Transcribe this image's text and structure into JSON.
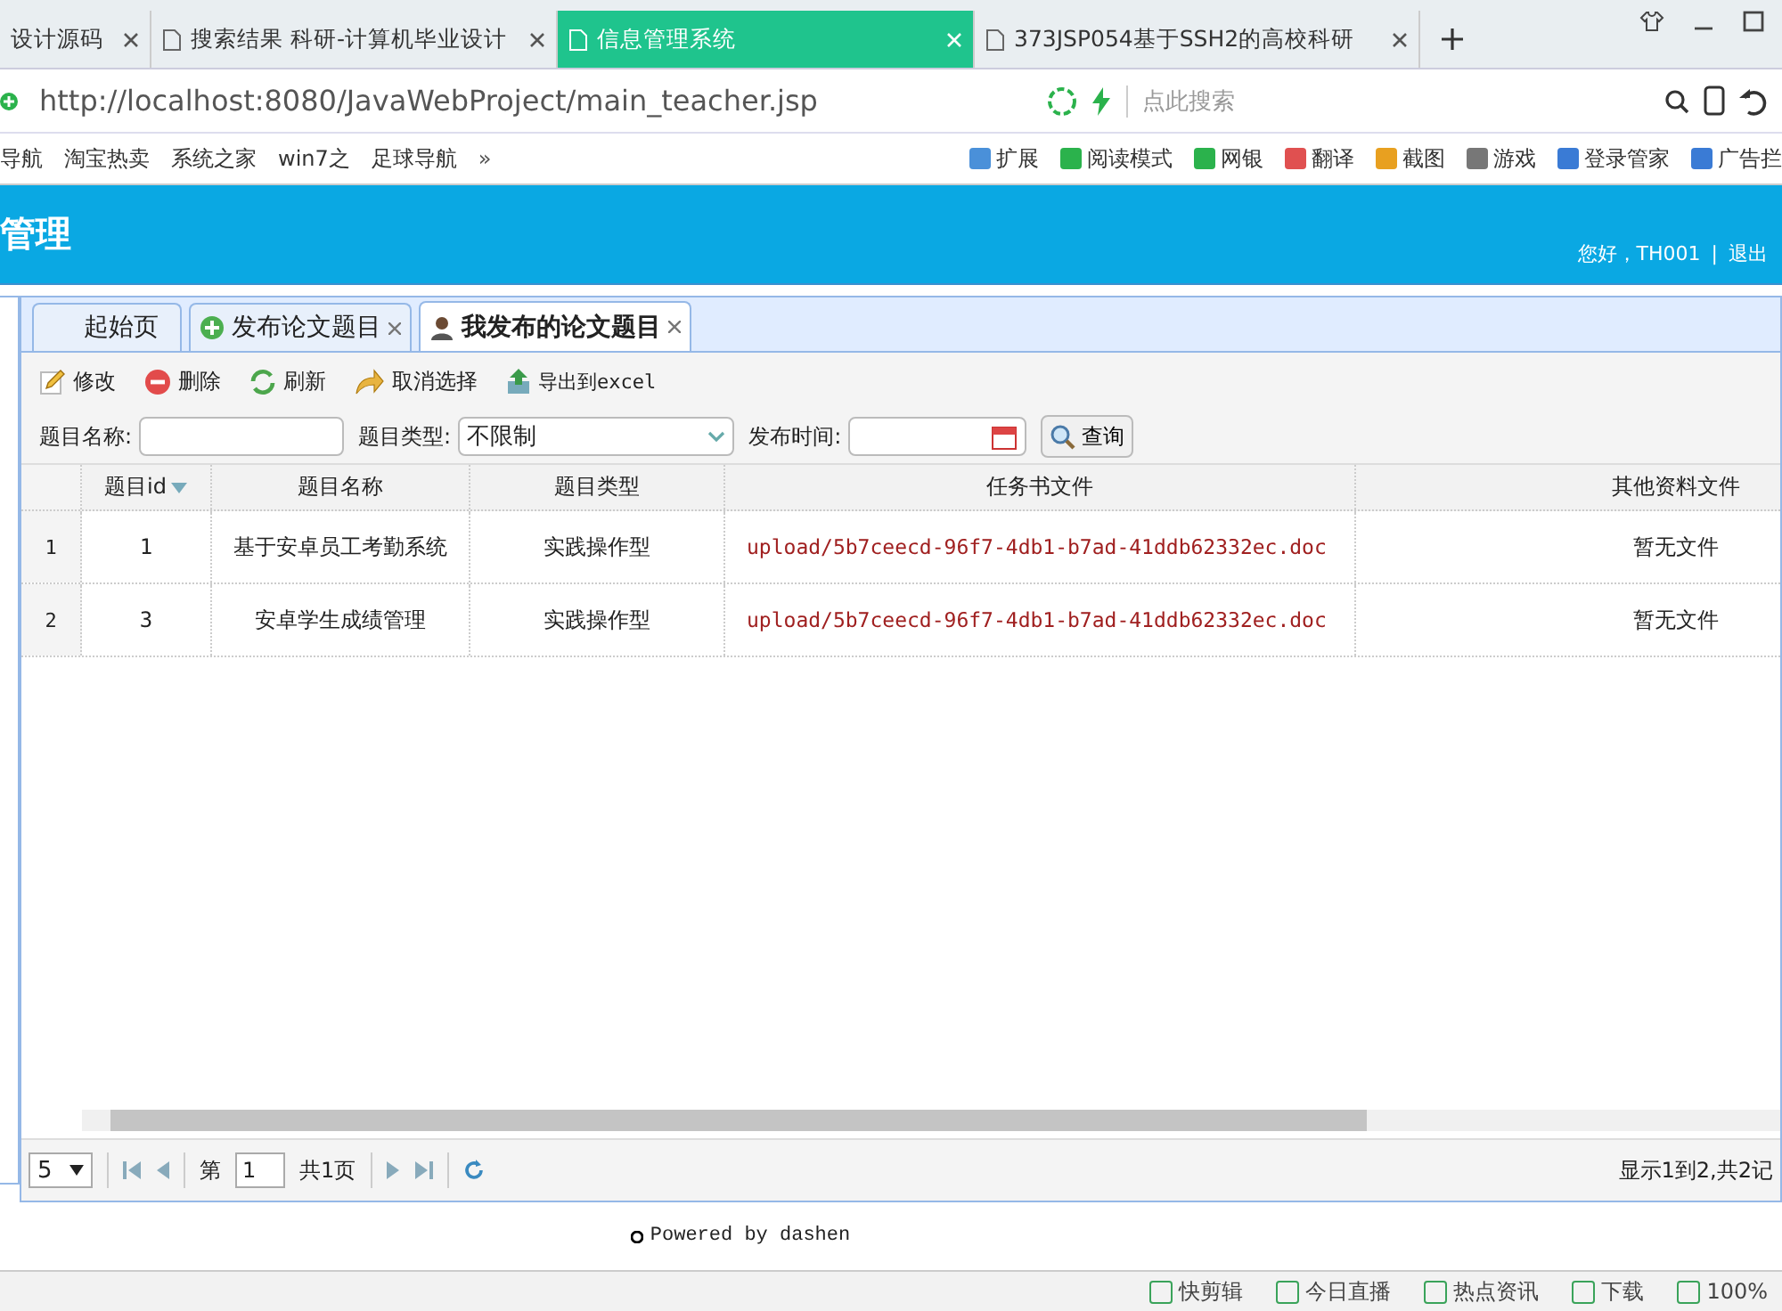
{
  "browser": {
    "tabs": [
      {
        "title": "设计源码",
        "selected": false
      },
      {
        "title": "搜索结果 科研-计算机毕业设计",
        "selected": false
      },
      {
        "title": "信息管理系统",
        "selected": true
      },
      {
        "title": "373JSP054基于SSH2的高校科研",
        "selected": false
      }
    ],
    "url": "http://localhost:8080/JavaWebProject/main_teacher.jsp",
    "search_placeholder": "点此搜索",
    "bookmarks": [
      "导航",
      "淘宝热卖",
      "系统之家",
      "win7之",
      "足球导航"
    ],
    "bookmarks_more": "»",
    "extensions": [
      "扩展",
      "阅读模式",
      "网银",
      "翻译",
      "截图",
      "游戏",
      "登录管家",
      "广告拦"
    ]
  },
  "app": {
    "title": "管理",
    "greeting": "您好，TH001",
    "separator": "|",
    "logout": "退出"
  },
  "page_tabs": [
    {
      "label": "起始页",
      "selected": false,
      "kind": "home",
      "closable": false
    },
    {
      "label": "发布论文题目",
      "selected": false,
      "kind": "add",
      "closable": true
    },
    {
      "label": "我发布的论文题目",
      "selected": true,
      "kind": "user",
      "closable": true
    }
  ],
  "toolbar": [
    {
      "label": "修改",
      "kind": "edit"
    },
    {
      "label": "删除",
      "kind": "delete"
    },
    {
      "label": "刷新",
      "kind": "refresh"
    },
    {
      "label": "取消选择",
      "kind": "cancel"
    },
    {
      "label": "导出到excel",
      "kind": "export"
    }
  ],
  "filters": {
    "name_label": "题目名称:",
    "type_label": "题目类型:",
    "type_value": "不限制",
    "time_label": "发布时间:",
    "query": "查询"
  },
  "table": {
    "columns": [
      {
        "label": "题目id",
        "sorted": true
      },
      {
        "label": "题目名称",
        "sorted": false
      },
      {
        "label": "题目类型",
        "sorted": false
      },
      {
        "label": "任务书文件",
        "sorted": false
      },
      {
        "label": "其他资料文件",
        "sorted": false
      }
    ],
    "rows": [
      {
        "index": "1",
        "cells": [
          "1",
          "基于安卓员工考勤系统",
          "实践操作型",
          "upload/5b7ceecd-96f7-4db1-b7ad-41ddb62332ec.doc",
          "暂无文件"
        ]
      },
      {
        "index": "2",
        "cells": [
          "3",
          "安卓学生成绩管理",
          "实践操作型",
          "upload/5b7ceecd-96f7-4db1-b7ad-41ddb62332ec.doc",
          "暂无文件"
        ]
      }
    ]
  },
  "pager": {
    "page_size": "5",
    "page_label": "第",
    "page_value": "1",
    "total": "共1页",
    "info": "显示1到2,共2记"
  },
  "footer": "Powered by dashen",
  "status_bar": [
    "快剪辑",
    "今日直播",
    "热点资讯",
    "下载",
    "100%"
  ]
}
